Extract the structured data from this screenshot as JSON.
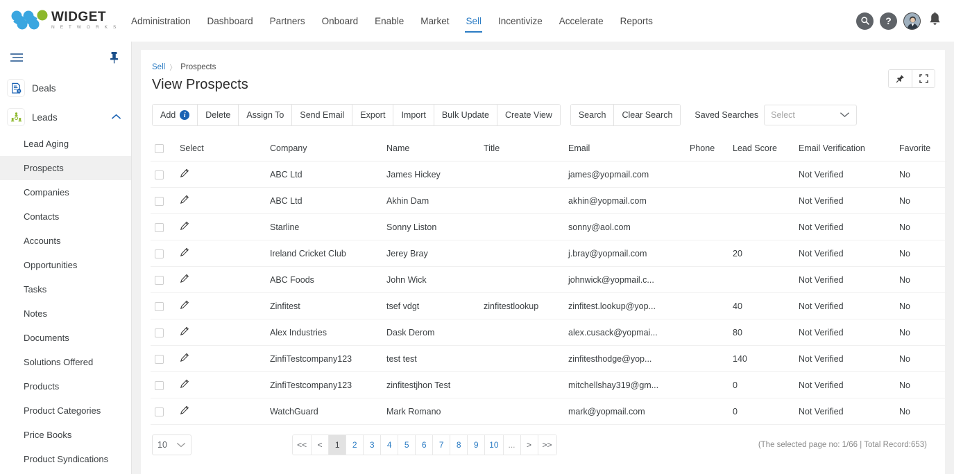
{
  "brand": {
    "name": "WIDGET",
    "sub": "N E T W O R K S",
    "blue": "#3aa6e0",
    "green": "#8cb82b"
  },
  "topnav": {
    "links": [
      {
        "label": "Administration",
        "active": false
      },
      {
        "label": "Dashboard",
        "active": false
      },
      {
        "label": "Partners",
        "active": false
      },
      {
        "label": "Onboard",
        "active": false
      },
      {
        "label": "Enable",
        "active": false
      },
      {
        "label": "Market",
        "active": false
      },
      {
        "label": "Sell",
        "active": true
      },
      {
        "label": "Incentivize",
        "active": false
      },
      {
        "label": "Accelerate",
        "active": false
      },
      {
        "label": "Reports",
        "active": false
      }
    ],
    "icons": [
      "search-icon",
      "help-icon",
      "avatar",
      "notification-bell-icon"
    ],
    "accent": "#2b7cc4"
  },
  "sidebar": {
    "groups": [
      {
        "label": "Deals",
        "icon": "deals-document-icon",
        "expanded": false
      },
      {
        "label": "Leads",
        "icon": "leads-people-icon",
        "expanded": true
      }
    ],
    "items": [
      {
        "label": "Lead Aging",
        "active": false
      },
      {
        "label": "Prospects",
        "active": true
      },
      {
        "label": "Companies",
        "active": false
      },
      {
        "label": "Contacts",
        "active": false
      },
      {
        "label": "Accounts",
        "active": false
      },
      {
        "label": "Opportunities",
        "active": false
      },
      {
        "label": "Tasks",
        "active": false
      },
      {
        "label": "Notes",
        "active": false
      },
      {
        "label": "Documents",
        "active": false
      },
      {
        "label": "Solutions Offered",
        "active": false
      },
      {
        "label": "Products",
        "active": false
      },
      {
        "label": "Product Categories",
        "active": false
      },
      {
        "label": "Price Books",
        "active": false
      },
      {
        "label": "Product Syndications",
        "active": false
      }
    ]
  },
  "breadcrumb": {
    "parent": "Sell",
    "separator": "〉",
    "current": "Prospects"
  },
  "page": {
    "title": "View Prospects"
  },
  "title_actions": [
    {
      "name": "pin-icon"
    },
    {
      "name": "fullscreen-icon"
    }
  ],
  "toolbar": {
    "group1": [
      "Add",
      "Delete",
      "Assign To",
      "Send Email",
      "Export",
      "Import",
      "Bulk Update",
      "Create View"
    ],
    "group2": [
      "Search",
      "Clear Search"
    ],
    "add_info_badge": "i",
    "saved_searches_label": "Saved Searches",
    "saved_searches_value": "Select"
  },
  "table": {
    "columns": [
      "Select",
      "",
      "Company",
      "Name",
      "Title",
      "Email",
      "Phone",
      "Lead Score",
      "Email Verification",
      "Favorite"
    ],
    "rows": [
      {
        "company": "ABC Ltd",
        "name": "James Hickey",
        "title": "",
        "email": "james@yopmail.com",
        "phone": "",
        "score": "",
        "verification": "Not Verified",
        "favorite": "No"
      },
      {
        "company": "ABC Ltd",
        "name": "Akhin Dam",
        "title": "",
        "email": "akhin@yopmail.com",
        "phone": "",
        "score": "",
        "verification": "Not Verified",
        "favorite": "No"
      },
      {
        "company": "Starline",
        "name": "Sonny Liston",
        "title": "",
        "email": "sonny@aol.com",
        "phone": "",
        "score": "",
        "verification": "Not Verified",
        "favorite": "No"
      },
      {
        "company": "Ireland Cricket Club",
        "name": "Jerey Bray",
        "title": "",
        "email": "j.bray@yopmail.com",
        "phone": "",
        "score": "20",
        "verification": "Not Verified",
        "favorite": "No"
      },
      {
        "company": "ABC Foods",
        "name": "John Wick",
        "title": "",
        "email": "johnwick@yopmail.c...",
        "phone": "",
        "score": "",
        "verification": "Not Verified",
        "favorite": "No"
      },
      {
        "company": "Zinfitest",
        "name": "tsef vdgt",
        "title": "zinfitestlookup",
        "email": "zinfitest.lookup@yop...",
        "phone": "",
        "score": "40",
        "verification": "Not Verified",
        "favorite": "No"
      },
      {
        "company": "Alex Industries",
        "name": "Dask Derom",
        "title": "",
        "email": "alex.cusack@yopmai...",
        "phone": "",
        "score": "80",
        "verification": "Not Verified",
        "favorite": "No"
      },
      {
        "company": "ZinfiTestcompany123",
        "name": "test test",
        "title": "",
        "email": "zinfitesthodge@yop...",
        "phone": "",
        "score": "140",
        "verification": "Not Verified",
        "favorite": "No"
      },
      {
        "company": "ZinfiTestcompany123",
        "name": "zinfitestjhon Test",
        "title": "",
        "email": "mitchellshay319@gm...",
        "phone": "",
        "score": "0",
        "verification": "Not Verified",
        "favorite": "No"
      },
      {
        "company": "WatchGuard",
        "name": "Mark Romano",
        "title": "",
        "email": "mark@yopmail.com",
        "phone": "",
        "score": "0",
        "verification": "Not Verified",
        "favorite": "No"
      }
    ]
  },
  "footer": {
    "page_size": "10",
    "pager": [
      {
        "label": "<<",
        "type": "nav"
      },
      {
        "label": "<",
        "type": "nav"
      },
      {
        "label": "1",
        "type": "active"
      },
      {
        "label": "2",
        "type": "page"
      },
      {
        "label": "3",
        "type": "page"
      },
      {
        "label": "4",
        "type": "page"
      },
      {
        "label": "5",
        "type": "page"
      },
      {
        "label": "6",
        "type": "page"
      },
      {
        "label": "7",
        "type": "page"
      },
      {
        "label": "8",
        "type": "page"
      },
      {
        "label": "9",
        "type": "page"
      },
      {
        "label": "10",
        "type": "page"
      },
      {
        "label": "...",
        "type": "dots"
      },
      {
        "label": ">",
        "type": "nav"
      },
      {
        "label": ">>",
        "type": "nav"
      }
    ],
    "record_info": "(The selected page no: 1/66 | Total Record:653)"
  }
}
